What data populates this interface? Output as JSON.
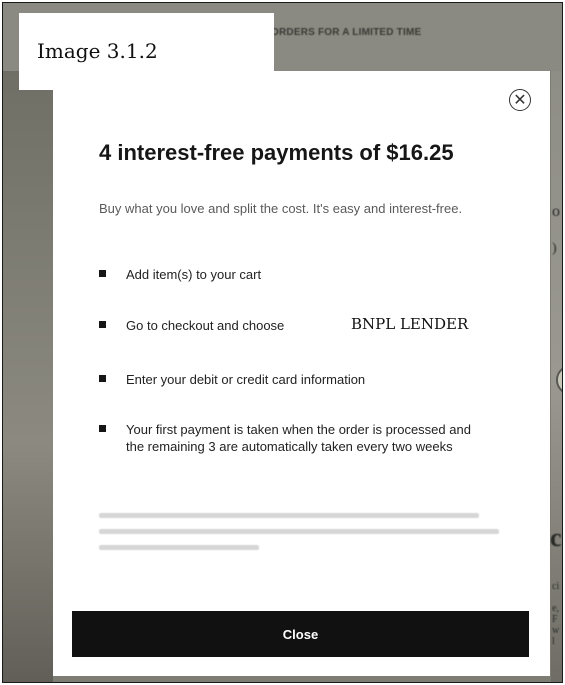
{
  "caption": "Image 3.1.2",
  "background": {
    "promo_text": "ORDERS FOR A LIMITED TIME",
    "right_fragments": [
      "o",
      ")",
      "c",
      "ci",
      "e, F",
      "w l"
    ]
  },
  "modal": {
    "title": "4 interest-free payments of $16.25",
    "subtitle": "Buy what you love and split the cost. It's easy and interest-free.",
    "steps": [
      "Add item(s) to your cart",
      "Go to checkout and choose",
      "Enter your debit or credit card information",
      "Your first payment is taken when the order is processed and the remaining 3 are automatically taken every two weeks"
    ],
    "lender_label": "BNPL LENDER",
    "close_button": "Close",
    "close_icon": "close-icon"
  },
  "colors": {
    "button_bg": "#111111",
    "button_text": "#ffffff",
    "backdrop": "#7d7d74"
  }
}
